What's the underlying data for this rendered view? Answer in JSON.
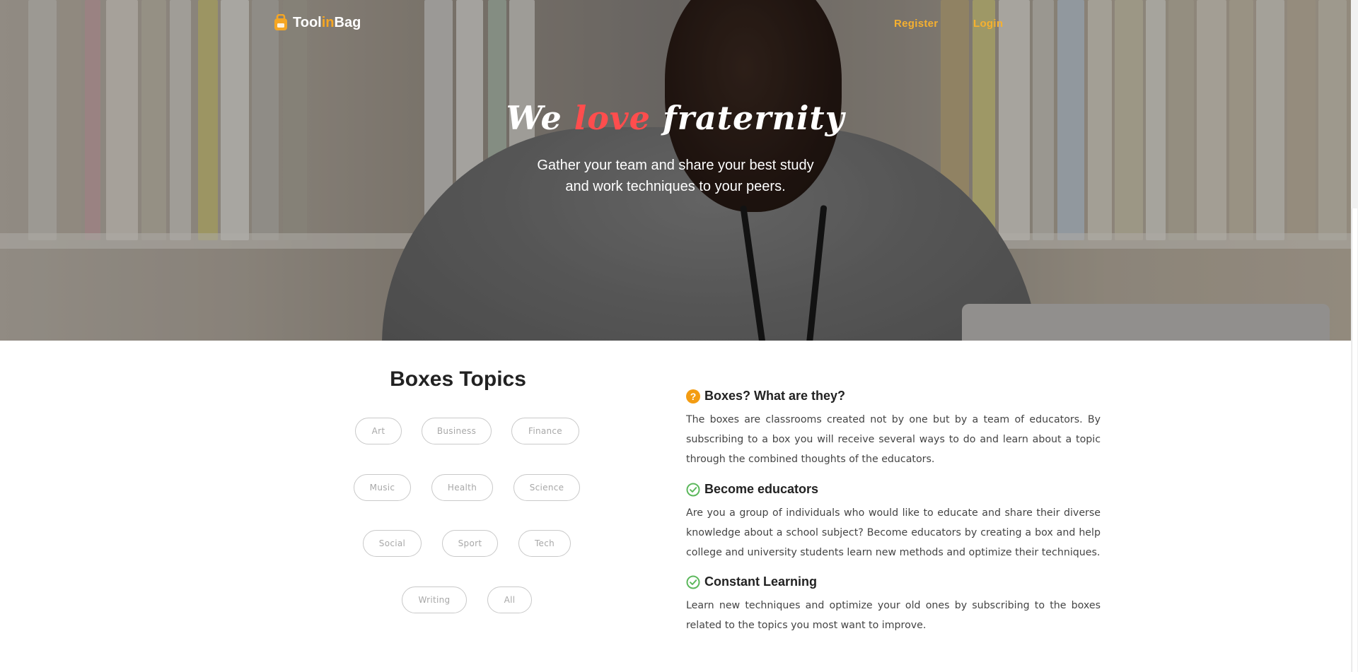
{
  "brand": {
    "name_prefix": "Tool",
    "name_highlight": "in",
    "name_suffix": "Bag",
    "accent_color": "#f5a623"
  },
  "nav": {
    "register": "Register",
    "login": "Login"
  },
  "hero": {
    "title_before": "We",
    "title_highlight": "love",
    "title_after": "fraternity",
    "subtitle_line1": "Gather your team and share your best study",
    "subtitle_line2": "and work techniques to your peers."
  },
  "topics": {
    "title": "Boxes Topics",
    "tags": [
      "Art",
      "Business",
      "Finance",
      "Music",
      "Health",
      "Science",
      "Social",
      "Sport",
      "Tech",
      "Writing",
      "All"
    ]
  },
  "info": {
    "sections": [
      {
        "icon": "question-circle-icon",
        "title": "Boxes? What are they?",
        "text": "The boxes are classrooms created not by one but by a team of educators. By subscribing to a box you will receive several ways to do and learn about a topic through the combined thoughts of the educators."
      },
      {
        "icon": "check-circle-icon",
        "title": "Become educators",
        "text": "Are you a group of individuals who would like to educate and share their diverse knowledge about a school subject? Become educators by creating a box and help college and university students learn new methods and optimize their techniques."
      },
      {
        "icon": "check-circle-icon",
        "title": "Constant Learning",
        "text": "Learn new techniques and optimize your old ones by subscribing to the boxes related to the topics you most want to improve."
      }
    ]
  },
  "colors": {
    "title_highlight": "#ff4d4d",
    "nav_link": "#f5b030",
    "question_icon": "#f39c12",
    "check_icon": "#5cb85c"
  }
}
